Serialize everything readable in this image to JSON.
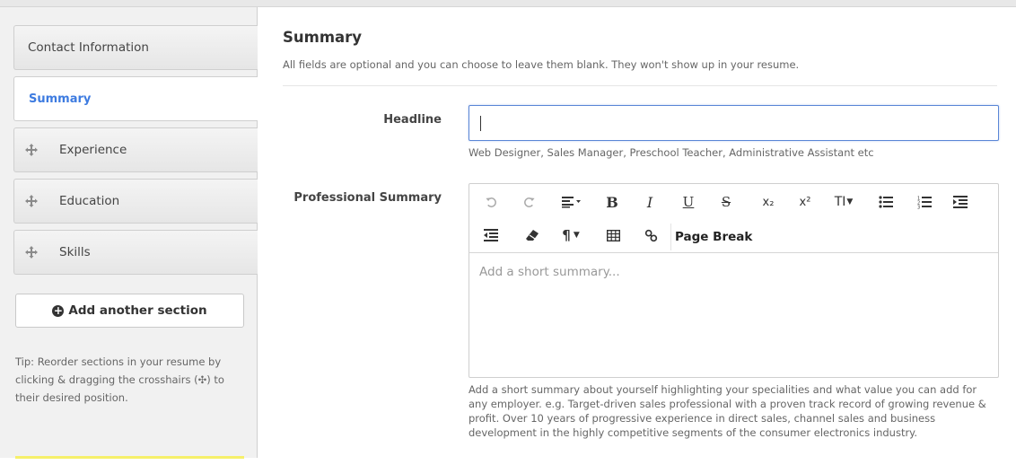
{
  "sidebar": {
    "items": [
      {
        "label": "Contact Information"
      },
      {
        "label": "Summary"
      },
      {
        "label": "Experience",
        "icon": "move-icon"
      },
      {
        "label": "Education",
        "icon": "move-icon"
      },
      {
        "label": "Skills",
        "icon": "move-icon"
      }
    ],
    "add_section_label": "Add another section",
    "tip": "Tip: Reorder sections in your resume by clicking & dragging the crosshairs (✣) to their desired position."
  },
  "main": {
    "title": "Summary",
    "subtitle": "All fields are optional and you can choose to leave them blank. They won't show up in your resume.",
    "headline": {
      "label": "Headline",
      "value": "",
      "hint": "Web Designer, Sales Manager, Preschool Teacher, Administrative Assistant etc"
    },
    "summary": {
      "label": "Professional Summary",
      "placeholder": "Add a short summary...",
      "page_break_label": "Page Break",
      "hint": "Add a short summary about yourself highlighting your specialities and what value you can add for any employer. e.g. Target-driven sales professional with a proven track record of growing revenue & profit. Over 10 years of progressive experience in direct sales, channel sales and business development in the highly competitive segments of the consumer electronics industry.",
      "toolbar_glyphs": {
        "bold": "B",
        "italic": "I",
        "underline": "U",
        "strike": "S",
        "subscript": "x₂",
        "superscript": "x²",
        "font_size": "TI",
        "paragraph": "¶"
      }
    }
  },
  "colors": {
    "accent": "#3d7be0",
    "tip_highlight": "#f6f06a"
  }
}
